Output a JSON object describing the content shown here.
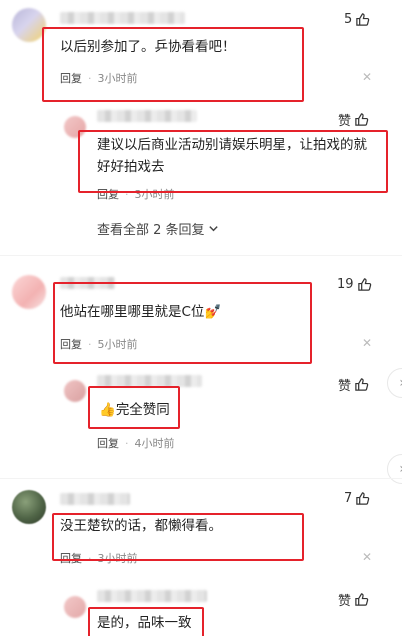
{
  "comments": [
    {
      "text": "以后别参加了。乒协看看吧！",
      "likes": "5",
      "reply": "回复",
      "time": "3小时前",
      "sub": {
        "text": "建议以后商业活动别请娱乐明星，让拍戏的就好好拍戏去",
        "likes": "赞",
        "reply": "回复",
        "time": "3小时前",
        "more": "查看全部 2 条回复"
      }
    },
    {
      "text": "他站在哪里哪里就是C位",
      "emoji": "💅",
      "likes": "19",
      "reply": "回复",
      "time": "5小时前",
      "sub": {
        "text": "完全赞同",
        "emoji": "👍",
        "likes": "赞",
        "reply": "回复",
        "time": "4小时前"
      }
    },
    {
      "text": "没王楚钦的话，都懒得看。",
      "likes": "7",
      "reply": "回复",
      "time": "3小时前",
      "sub": {
        "text": "是的，品味一致",
        "likes": "赞"
      }
    }
  ],
  "icons": {
    "like": "thumbs-up-icon",
    "close": "close-icon",
    "chevron": "chevron-down-icon"
  },
  "colors": {
    "highlight": "#e5222b"
  }
}
